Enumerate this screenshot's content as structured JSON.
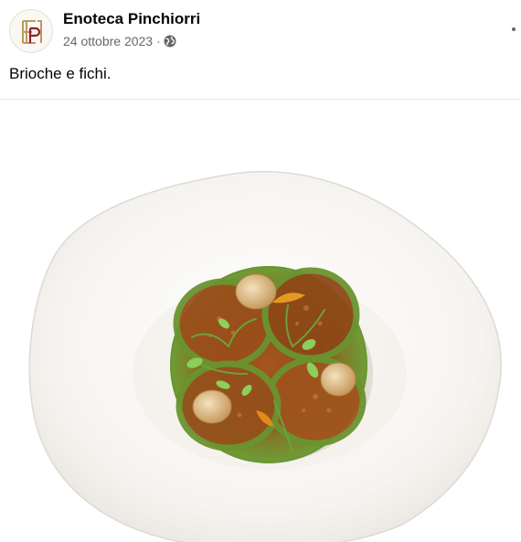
{
  "post": {
    "author": "Enoteca Pinchiorri",
    "date": "24 ottobre 2023",
    "separator": "·",
    "privacy_icon": "globe-icon",
    "more_icon": "more-options-icon",
    "text": "Brioche e fichi."
  },
  "avatar": {
    "logo_icon": "enoteca-pinchiorri-logo",
    "monogram": "EP"
  },
  "photo": {
    "subject": "fig-dessert-on-white-plate"
  },
  "colors": {
    "name_text": "#050505",
    "meta_text": "#65676b",
    "divider": "#e4e6eb",
    "logo_gold": "#b89a5f",
    "logo_red": "#8f1f2e"
  }
}
